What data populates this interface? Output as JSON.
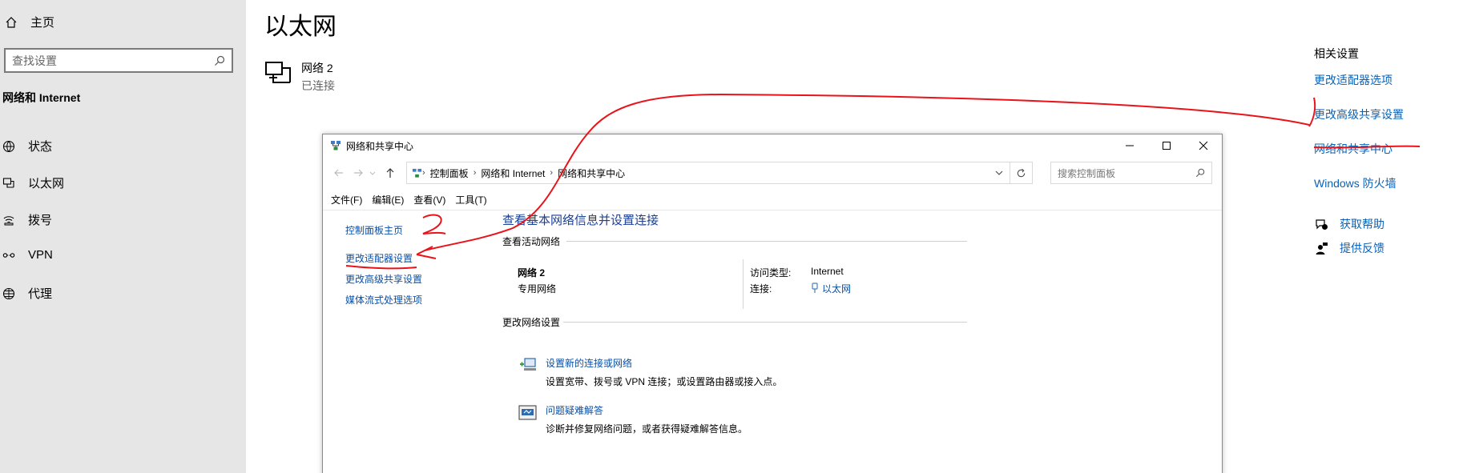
{
  "settings": {
    "home_label": "主页",
    "search_placeholder": "查找设置",
    "section_title": "网络和 Internet",
    "nav": [
      {
        "label": "状态",
        "icon": "globe-status-icon"
      },
      {
        "label": "以太网",
        "icon": "ethernet-icon"
      },
      {
        "label": "拨号",
        "icon": "dialup-icon"
      },
      {
        "label": "VPN",
        "icon": "vpn-icon"
      },
      {
        "label": "代理",
        "icon": "proxy-globe-icon"
      }
    ],
    "page_title": "以太网",
    "network": {
      "name": "网络 2",
      "status": "已连接"
    },
    "related": {
      "title": "相关设置",
      "links": [
        "更改适配器选项",
        "更改高级共享设置",
        "网络和共享中心",
        "Windows 防火墙"
      ]
    },
    "help": {
      "get_help": "获取帮助",
      "feedback": "提供反馈"
    }
  },
  "window": {
    "title": "网络和共享中心",
    "breadcrumb": [
      "控制面板",
      "网络和 Internet",
      "网络和共享中心"
    ],
    "search_placeholder": "搜索控制面板",
    "menu": [
      "文件(F)",
      "编辑(E)",
      "查看(V)",
      "工具(T)"
    ],
    "left_pane": {
      "home": "控制面板主页",
      "links": [
        "更改适配器设置",
        "更改高级共享设置",
        "媒体流式处理选项"
      ]
    },
    "heading": "查看基本网络信息并设置连接",
    "active_group": "查看活动网络",
    "active_network": {
      "name": "网络 2",
      "type": "专用网络",
      "access_label": "访问类型:",
      "access_value": "Internet",
      "conn_label": "连接:",
      "conn_value": "以太网"
    },
    "change_group": "更改网络设置",
    "tasks": [
      {
        "title": "设置新的连接或网络",
        "desc": "设置宽带、拨号或 VPN 连接；或设置路由器或接入点。"
      },
      {
        "title": "问题疑难解答",
        "desc": "诊断并修复网络问题，或者获得疑难解答信息。"
      }
    ]
  },
  "colors": {
    "link": "#0a62b8",
    "annotation": "#e8141a",
    "sidebar_bg": "#e6e6e6"
  }
}
